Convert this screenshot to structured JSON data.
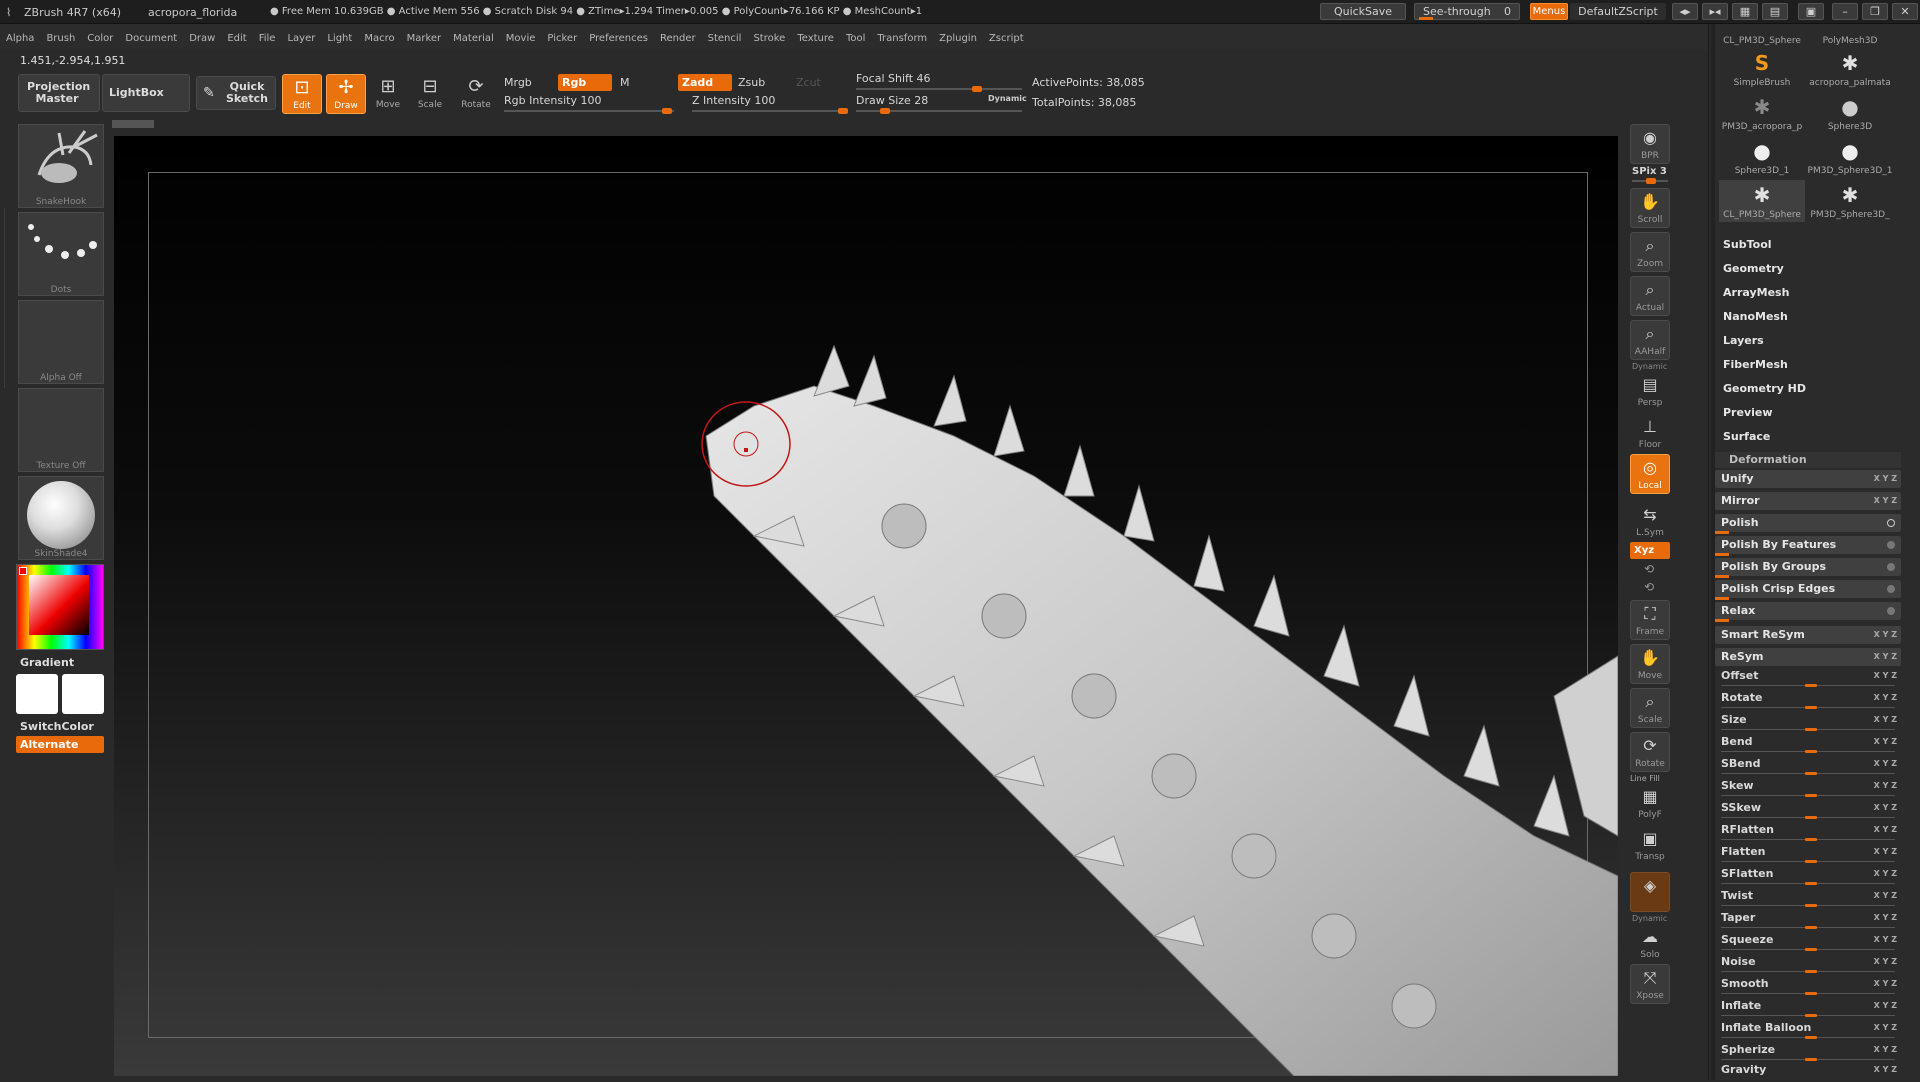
{
  "titlebar": {
    "app": "ZBrush 4R7 (x64)",
    "document": "acropora_florida",
    "stats": "● Free Mem 10.639GB ● Active Mem 556 ● Scratch Disk 94 ● ZTime▸1.294 Timer▸0.005 ● PolyCount▸76.166 KP ● MeshCount▸1",
    "quicksave": "QuickSave",
    "see_through": "See-through",
    "see_through_value": "0",
    "menus": "Menus",
    "zscript": "DefaultZScript"
  },
  "menubar": [
    "Alpha",
    "Brush",
    "Color",
    "Document",
    "Draw",
    "Edit",
    "File",
    "Layer",
    "Light",
    "Macro",
    "Marker",
    "Material",
    "Movie",
    "Picker",
    "Preferences",
    "Render",
    "Stencil",
    "Stroke",
    "Texture",
    "Tool",
    "Transform",
    "Zplugin",
    "Zscript"
  ],
  "coords": "1.451,-2.954,1.951",
  "toolbar": {
    "projection_master": "Projection Master",
    "lightbox": "LightBox",
    "quick_sketch": "Quick Sketch",
    "edit": "Edit",
    "draw": "Draw",
    "move": "Move",
    "scale": "Scale",
    "rotate": "Rotate",
    "mrgb": "Mrgb",
    "rgb": "Rgb",
    "m": "M",
    "rgb_intensity": "Rgb Intensity 100",
    "zadd": "Zadd",
    "zsub": "Zsub",
    "zcut": "Zcut",
    "z_intensity": "Z Intensity 100",
    "focal_shift": "Focal Shift 46",
    "draw_size": "Draw Size 28",
    "dynamic": "Dynamic",
    "active_points": "ActivePoints: 38,085",
    "total_points": "TotalPoints: 38,085"
  },
  "left_shelf": {
    "brush": "SnakeHook",
    "stroke": "Dots",
    "alpha": "Alpha Off",
    "texture": "Texture Off",
    "material": "SkinShade4",
    "gradient": "Gradient",
    "switch_color": "SwitchColor",
    "alternate": "Alternate"
  },
  "right_shelf": [
    {
      "label": "BPR",
      "icon": "bpr-icon"
    },
    {
      "label": "SPix 3",
      "icon": ""
    },
    {
      "label": "Scroll",
      "icon": "scroll-icon"
    },
    {
      "label": "Zoom",
      "icon": "zoom-icon"
    },
    {
      "label": "Actual",
      "icon": "actual-icon"
    },
    {
      "label": "AAHalf",
      "icon": "aahalf-icon"
    },
    {
      "label": "Persp",
      "icon": "persp-icon"
    },
    {
      "label": "Floor",
      "icon": "floor-icon"
    },
    {
      "label": "Local",
      "icon": "local-icon"
    },
    {
      "label": "L.Sym",
      "icon": "lsym-icon"
    },
    {
      "label": "Frame",
      "icon": "frame-icon"
    },
    {
      "label": "Move",
      "icon": "move-icon"
    },
    {
      "label": "Scale",
      "icon": "scale-icon"
    },
    {
      "label": "Rotate",
      "icon": "rotate-icon"
    },
    {
      "label": "PolyF",
      "icon": "polyf-icon"
    },
    {
      "label": "Transp",
      "icon": "transp-icon"
    },
    {
      "label": "Solo",
      "icon": "solo-icon"
    },
    {
      "label": "Xpose",
      "icon": "xpose-icon"
    }
  ],
  "right_shelf_extra": {
    "dynamic": "Dynamic",
    "line_fill": "Line Fill",
    "xyz": "Xyz"
  },
  "tray": {
    "brushes": [
      {
        "label": "CL_PM3D_Sphere",
        "glyph": "✱"
      },
      {
        "label": "PolyMesh3D",
        "glyph": "✱"
      },
      {
        "label": "SimpleBrush",
        "glyph": "S"
      },
      {
        "label": "acropora_palmata",
        "glyph": "✱"
      },
      {
        "label": "PM3D_acropora_p",
        "glyph": "✱"
      },
      {
        "label": "Sphere3D",
        "glyph": "●"
      },
      {
        "label": "Sphere3D_1",
        "glyph": "●"
      },
      {
        "label": "PM3D_Sphere3D_1",
        "glyph": "●"
      },
      {
        "label": "CL_PM3D_Sphere",
        "glyph": "✱"
      },
      {
        "label": "PM3D_Sphere3D_",
        "glyph": "✱"
      }
    ],
    "sections": [
      "SubTool",
      "Geometry",
      "ArrayMesh",
      "NanoMesh",
      "Layers",
      "FiberMesh",
      "Geometry HD",
      "Preview",
      "Surface"
    ],
    "deformation_header": "Deformation",
    "deform_buttons": [
      "Unify",
      "Mirror",
      "Polish",
      "Polish By Features",
      "Polish By Groups",
      "Polish Crisp Edges",
      "Relax",
      "Smart ReSym",
      "ReSym"
    ],
    "deform_sliders": [
      "Offset",
      "Rotate",
      "Size",
      "Bend",
      "SBend",
      "Skew",
      "SSkew",
      "RFlatten",
      "Flatten",
      "SFlatten",
      "Twist",
      "Taper",
      "Squeeze",
      "Noise",
      "Smooth",
      "Inflate",
      "Inflate Balloon",
      "Spherize",
      "Gravity"
    ],
    "xyz": "X Y Z"
  }
}
